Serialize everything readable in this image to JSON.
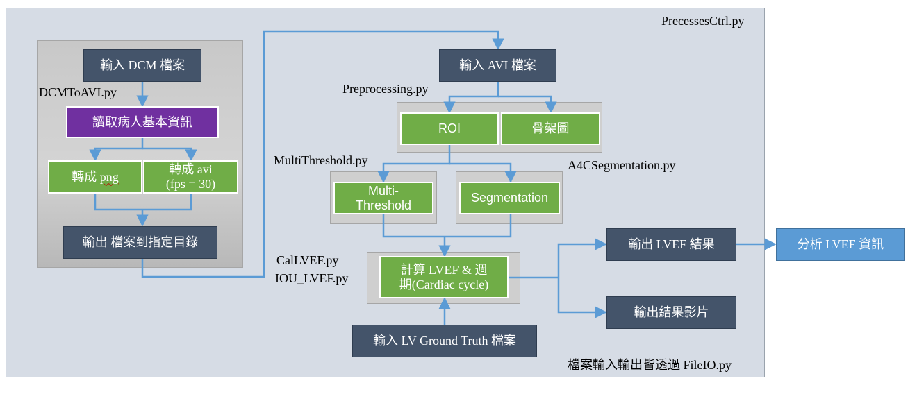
{
  "labels": {
    "processes_ctrl": "PrecessesCtrl.py",
    "dcm_to_avi": "DCMToAVI.py",
    "preprocessing": "Preprocessing.py",
    "multi_threshold_py": "MultiThreshold.py",
    "a4c_segmentation": "A4CSegmentation.py",
    "cal_lvef": "CalLVEF.py",
    "iou_lvef": "IOU_LVEF.py",
    "file_io": "檔案輸入輸出皆透過 FileIO.py"
  },
  "boxes": {
    "input_dcm": "輸入 DCM 檔案",
    "read_patient_info": "讀取病人基本資訊",
    "to_png_prefix": "轉成 ",
    "to_png_word": "png",
    "to_avi_line1": "轉成 avi",
    "to_avi_line2": "(fps = 30)",
    "output_to_dir": "輸出 檔案到指定目錄",
    "input_avi": "輸入 AVI 檔案",
    "roi": "ROI",
    "skeleton": "骨架圖",
    "multi_threshold_line1": "Multi-",
    "multi_threshold_line2": "Threshold",
    "segmentation": "Segmentation",
    "calc_line1": "計算 LVEF & 週",
    "calc_line2": "期(Cardiac cycle)",
    "input_lv_gt": "輸入 LV Ground Truth 檔案",
    "output_lvef_result": "輸出 LVEF 結果",
    "output_result_video": "輸出結果影片",
    "analyze_lvef": "分析 LVEF 資訊"
  },
  "colors": {
    "background_panel": "#d6dce5",
    "navy_box": "#44546a",
    "green_box": "#70ad47",
    "purple_box": "#7030a0",
    "blue_box": "#5b9bd5",
    "connector": "#5b9bd5"
  }
}
